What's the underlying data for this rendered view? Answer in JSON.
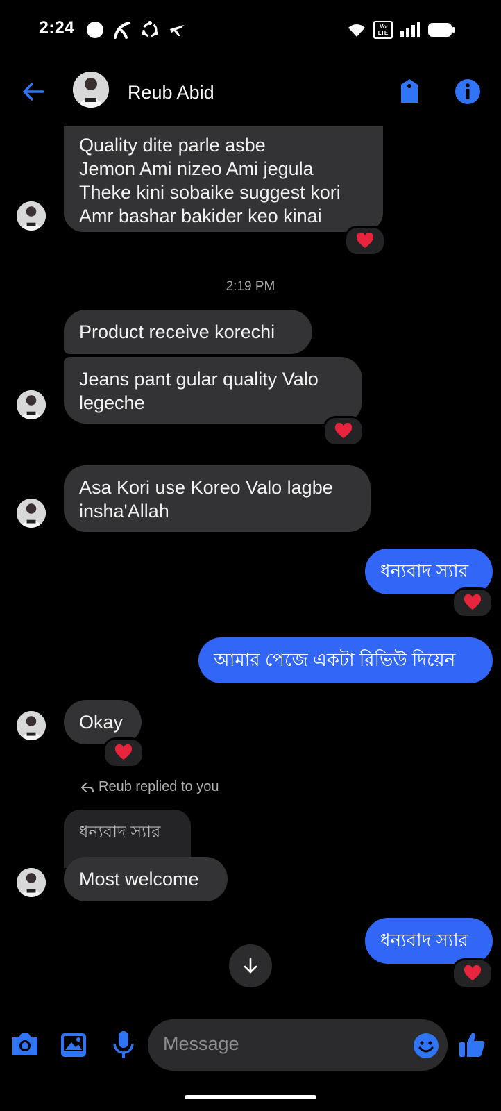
{
  "status_bar": {
    "time": "2:24",
    "volte_top": "Vo",
    "volte_bottom": "LTE"
  },
  "header": {
    "contact_name": "Reub Abid"
  },
  "messages": {
    "m1_lines": [
      "Quality dite parle asbe",
      "Jemon Ami nizeo Ami jegula",
      "Theke kini sobaike suggest kori",
      "Amr bashar bakider keo kinai"
    ],
    "timestamp": "2:19 PM",
    "m2": "Product receive korechi",
    "m3_line1": "Jeans pant gular quality Valo",
    "m3_line2": "legeche",
    "m4_line1": "Asa Kori use Koreo Valo lagbe",
    "m4_line2": "insha'Allah",
    "m5_out": "ধন্যবাদ স্যার",
    "m6_out": "আমার পেজে একটা রিভিউ দিয়েন",
    "m7": "Okay",
    "reply_meta": "Reub replied to you",
    "reply_quote": "ধন্যবাদ স্যার",
    "m8": "Most welcome",
    "m9_out": "ধন্যবাদ স্যার"
  },
  "composer": {
    "placeholder": "Message"
  },
  "colors": {
    "accent": "#3166f6",
    "incoming_bubble": "#333335",
    "background": "#000000",
    "heart": "#e8253c"
  },
  "icons": [
    "back-arrow-icon",
    "tag-icon",
    "info-icon",
    "camera-icon",
    "gallery-icon",
    "mic-icon",
    "emoji-icon",
    "like-icon",
    "heart-icon",
    "reply-icon",
    "arrow-down-icon"
  ]
}
